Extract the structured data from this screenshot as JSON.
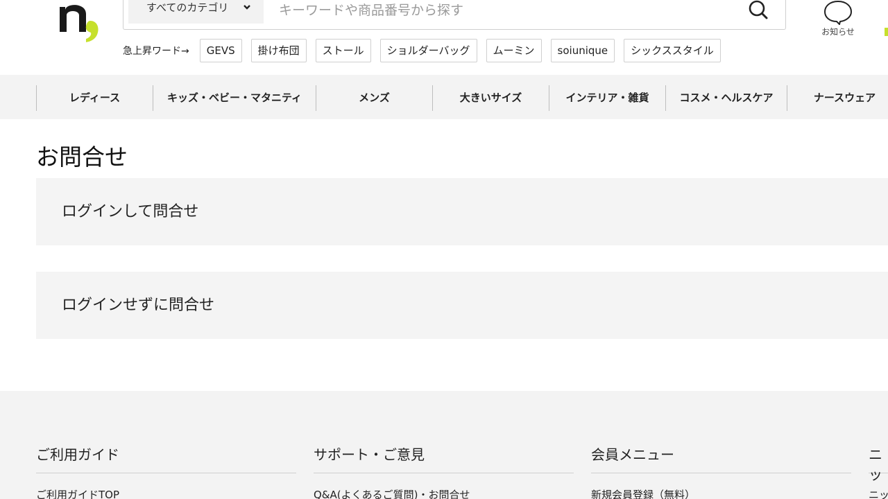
{
  "header": {
    "category_select": "すべてのカテゴリ",
    "search_placeholder": "キーワードや商品番号から探す",
    "notice_label": "お知らせ"
  },
  "trending": {
    "label": "急上昇ワード→",
    "tags": [
      "GEVS",
      "掛け布団",
      "ストール",
      "ショルダーバッグ",
      "ムーミン",
      "soiunique",
      "シックススタイル"
    ]
  },
  "category_nav": [
    "レディース",
    "キッズ・ベビー・マタニティ",
    "メンズ",
    "大きいサイズ",
    "インテリア・雑貨",
    "コスメ・ヘルスケア",
    "ナースウェア"
  ],
  "main": {
    "title": "お問合せ",
    "login_inquiry": "ログインして問合せ",
    "guest_inquiry": "ログインせずに問合せ"
  },
  "footer": {
    "columns": [
      {
        "heading": "ご利用ガイド",
        "link": "ご利用ガイドTOP"
      },
      {
        "heading": "サポート・ご意見",
        "link": "Q&A(よくあるご質問)・お問合せ"
      },
      {
        "heading": "会員メニュー",
        "link": "新規会員登録（無料）"
      },
      {
        "heading": "ニッ",
        "link": "ニッ"
      }
    ]
  },
  "colors": {
    "brand_green": "#c6e02c",
    "nav_background": "#f3f3f3",
    "panel_background": "#f4f4f4"
  }
}
